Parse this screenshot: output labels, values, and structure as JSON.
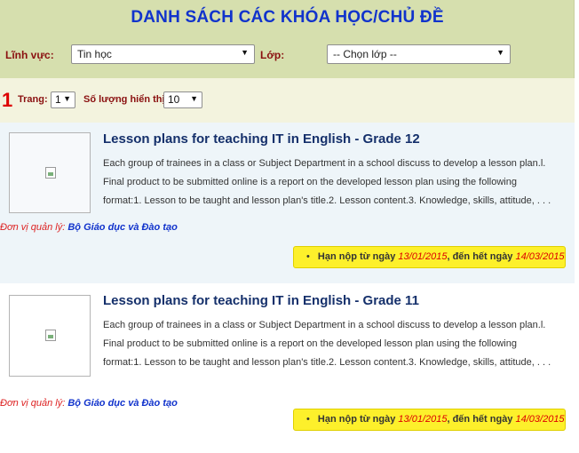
{
  "header": {
    "title": "DANH SÁCH CÁC KHÓA HỌC/CHỦ ĐỀ",
    "field_label": "Lĩnh vực:",
    "field_value": "Tin học",
    "class_label": "Lớp:",
    "class_value": "-- Chọn lớp --"
  },
  "pager": {
    "current_page": "1",
    "page_label": "Trang:",
    "page_value": "1",
    "count_label": "Số lượng hiển thị:",
    "count_value": "10"
  },
  "courses": [
    {
      "title": "Lesson plans for teaching IT in English - Grade 12",
      "desc_lines": [
        "Each group of trainees in a class or Subject Department in a school discuss to develop a lesson plan.l.",
        "Final product to be submitted online is a report on the developed lesson plan using the following",
        "format:1. Lesson to be taught and lesson plan's title.2. Lesson content.3. Knowledge, skills, attitude, . . ."
      ],
      "manager_label": "Đơn vị quản lý:",
      "manager_org": "Bộ Giáo dục và Đào tạo",
      "deadline_prefix": "Hạn nộp từ ngày",
      "start_date": "13/01/2015",
      "deadline_mid": ", đến hết ngày",
      "end_date": "14/03/2015"
    },
    {
      "title": "Lesson plans for teaching IT in English - Grade 11",
      "desc_lines": [
        "Each group of trainees in a class or Subject Department in a school discuss to develop a lesson plan.l.",
        "Final product to be submitted online is a report on the developed lesson plan using the following",
        "format:1. Lesson to be taught and lesson plan's title.2. Lesson content.3. Knowledge, skills, attitude, . . ."
      ],
      "manager_label": "Đơn vị quản lý:",
      "manager_org": "Bộ Giáo dục và Đào tạo",
      "deadline_prefix": "Hạn nộp từ ngày",
      "start_date": "13/01/2015",
      "deadline_mid": ", đến hết ngày",
      "end_date": "14/03/2015"
    }
  ],
  "colors": {
    "title_blue": "#1133cc",
    "label_red": "#8a1010",
    "deadline_yellow": "#fdf02b"
  }
}
